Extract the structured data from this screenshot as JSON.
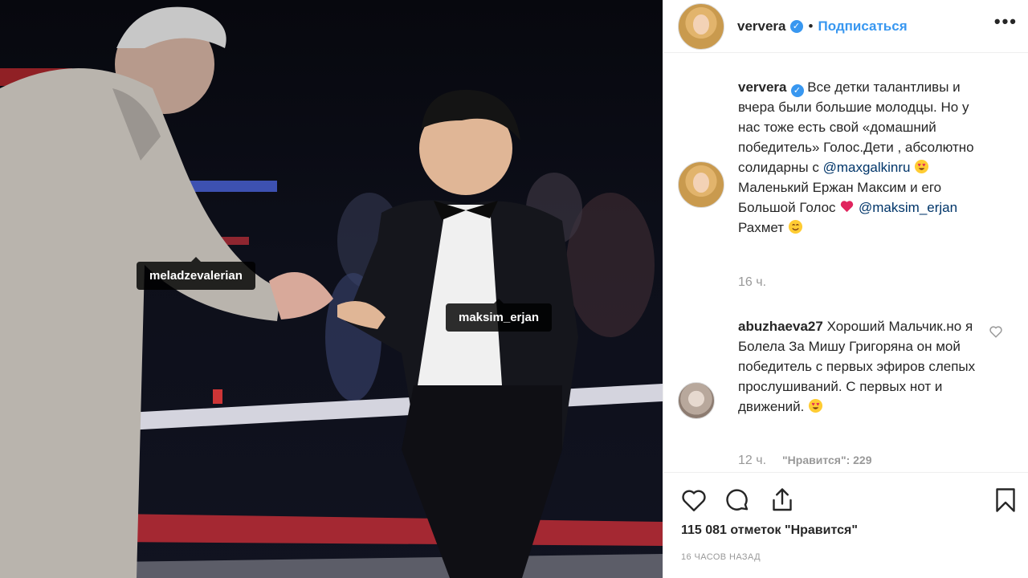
{
  "photo": {
    "tags": {
      "meladze": "meladzevalerian",
      "maksim": "maksim_erjan"
    }
  },
  "header": {
    "username": "ververa",
    "separator": "•",
    "follow_label": "Подписаться",
    "more_label": "•••"
  },
  "caption": {
    "username": "ververa",
    "line1": "Все детки талантливы и вчера были большие молодцы. Но у нас тоже есть свой «домашний победитель» Голос.Дети , абсолютно солидарны с",
    "mention1": "@maxgalkinru",
    "line2": "Маленький Ержан Максим и его Большой Голос",
    "mention2": "@maksim_erjan",
    "line3": "Рахмет",
    "time": "16 ч."
  },
  "comment": {
    "username": "abuzhaeva27",
    "text": "Хороший Мальчик.но я Болела За Мишу Григоряна он мой победитель с первых эфиров слепых прослушиваний. С первых нот и движений.",
    "time": "12 ч.",
    "likes": "\"Нравится\": 229"
  },
  "footer": {
    "likes_count": "115 081 отметок \"Нравится\"",
    "time_ago": "16 ЧАСОВ НАЗАД"
  },
  "icons": {
    "like": "heart-icon",
    "comment": "comment-icon",
    "share": "share-icon",
    "save": "bookmark-icon",
    "verified": "verified-badge-icon"
  },
  "colors": {
    "link": "#3897f0",
    "mention": "#003569",
    "muted": "#999999",
    "text": "#262626",
    "heart_emoji": "#e0245e"
  }
}
